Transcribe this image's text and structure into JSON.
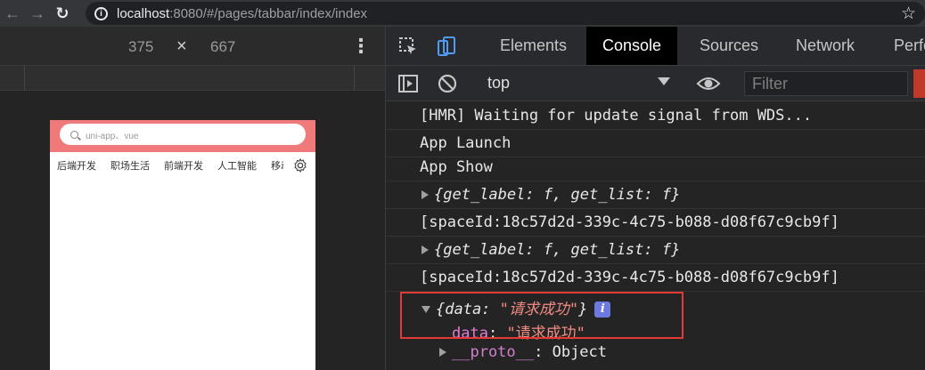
{
  "browser": {
    "url_host": "localhost",
    "url_path": ":8080/#/pages/tabbar/index/index"
  },
  "device": {
    "width": "375",
    "times": "×",
    "height": "667"
  },
  "app": {
    "search_placeholder": "uni-app、vue",
    "tabs": [
      "后端开发",
      "职场生活",
      "前端开发",
      "人工智能",
      "移动"
    ]
  },
  "devtools": {
    "tabs": [
      "Elements",
      "Console",
      "Sources",
      "Network",
      "Perfo"
    ],
    "active_tab": "Console",
    "context": "top",
    "filter_placeholder": "Filter"
  },
  "console": {
    "l1": "[HMR] Waiting for update signal from WDS...",
    "l2": "App Launch",
    "l3": "App Show",
    "l4": "{get_label: f, get_list: f}",
    "l5": "[spaceId:18c57d2d-339c-4c75-b088-d08f67c9cb9f]",
    "l6": "{get_label: f, get_list: f}",
    "l7": "[spaceId:18c57d2d-339c-4c75-b088-d08f67c9cb9f]",
    "l8_open": "{data: ",
    "l8_str": "\"请求成功\"",
    "l8_close": "}",
    "l8_badge": "i",
    "l9_key": "data",
    "l9_sep": ": ",
    "l9_val": "\"请求成功\"",
    "l10_proto": "__proto__",
    "l10_val": ": Object"
  },
  "colors": {
    "highlight": "#e53935",
    "app_header": "#f07a7a"
  }
}
